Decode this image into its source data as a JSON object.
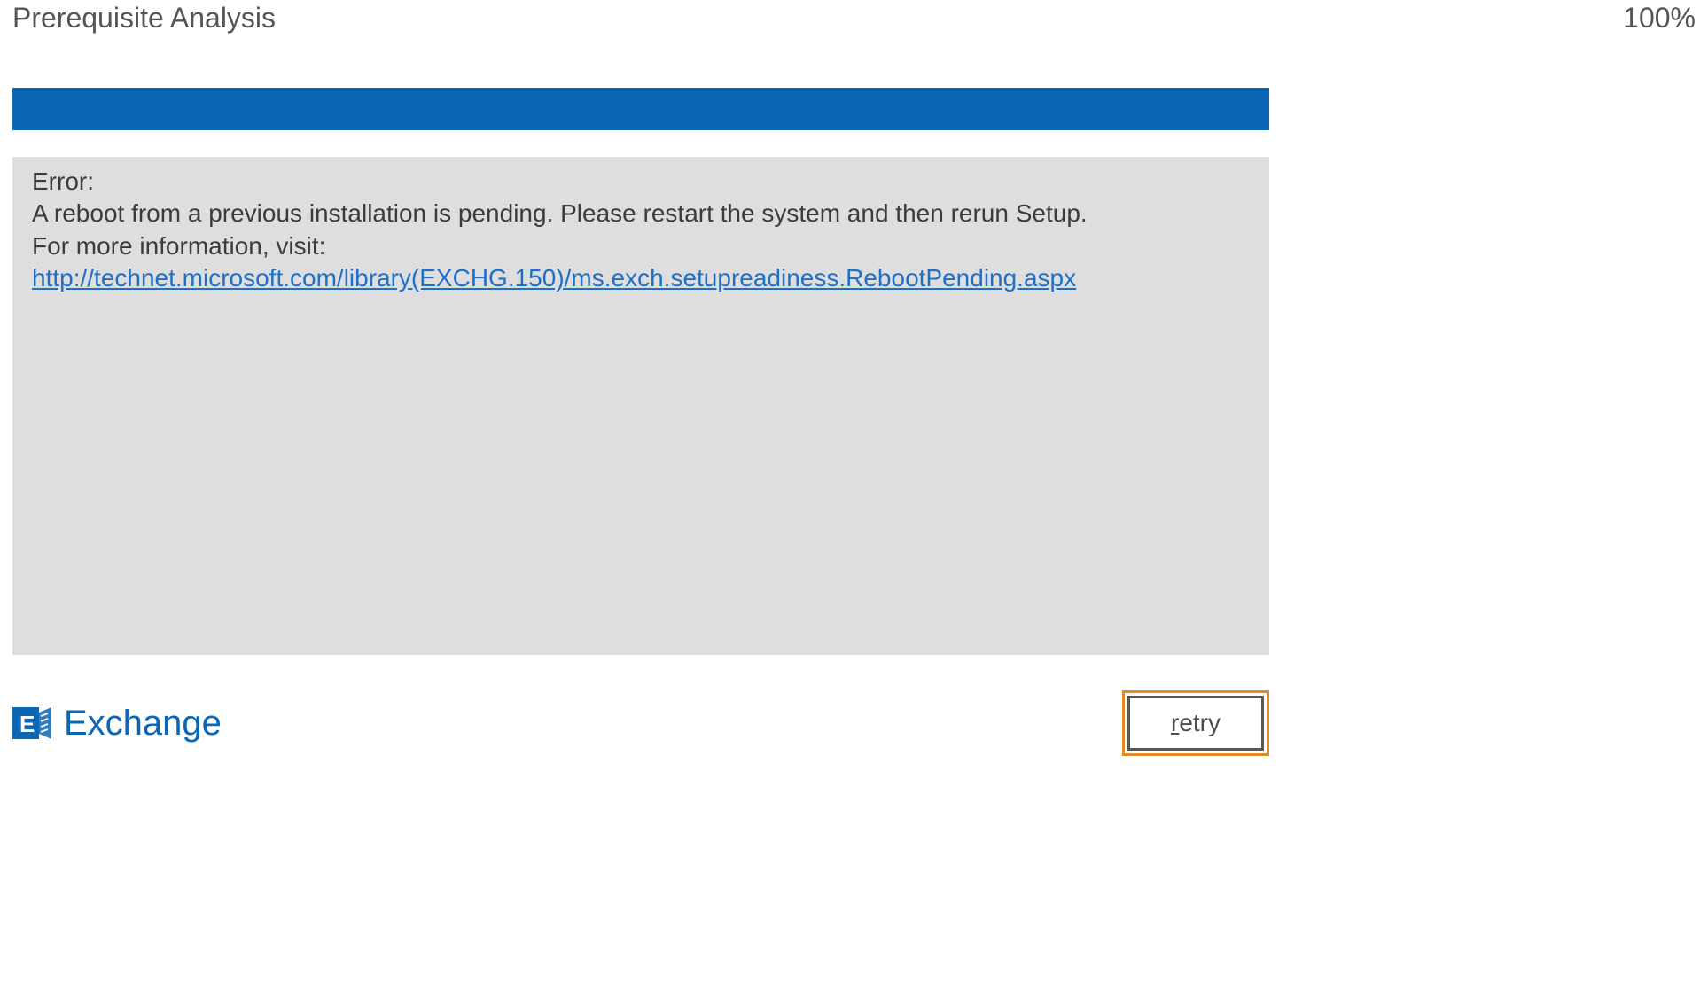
{
  "header": {
    "title": "Prerequisite Analysis",
    "percent": "100%"
  },
  "error": {
    "heading": "Error:",
    "body": "A reboot from a previous installation is pending. Please restart the system and then rerun Setup.",
    "more_info_prefix": "For more information, visit: ",
    "link_text": "http://technet.microsoft.com/library(EXCHG.150)/ms.exch.setupreadiness.RebootPending.aspx"
  },
  "brand": {
    "name": "Exchange"
  },
  "buttons": {
    "retry_first": "r",
    "retry_rest": "etry"
  }
}
